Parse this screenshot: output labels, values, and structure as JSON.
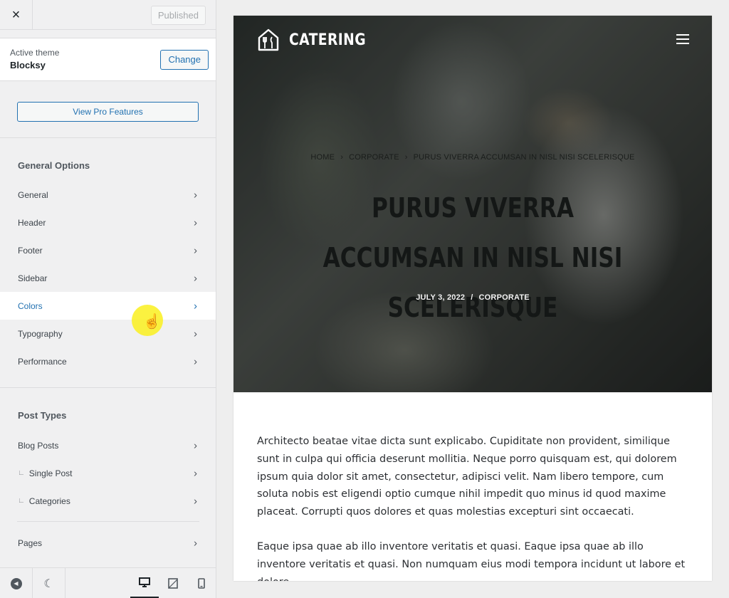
{
  "sidebar": {
    "close_label": "×",
    "publish_label": "Published",
    "active_theme_label": "Active theme",
    "theme_name": "Blocksy",
    "change_label": "Change",
    "pro_label": "View Pro Features",
    "general_options": {
      "title": "General Options",
      "items": [
        {
          "label": "General"
        },
        {
          "label": "Header"
        },
        {
          "label": "Footer"
        },
        {
          "label": "Sidebar"
        },
        {
          "label": "Colors",
          "active": true
        },
        {
          "label": "Typography"
        },
        {
          "label": "Performance"
        }
      ]
    },
    "post_types": {
      "title": "Post Types",
      "items": [
        {
          "label": "Blog Posts"
        },
        {
          "label": "Single Post",
          "sub": true
        },
        {
          "label": "Categories",
          "sub": true
        },
        {
          "label": "Pages"
        }
      ]
    },
    "sub_marker": "∟",
    "chevron": "›",
    "footer": {
      "collapse_icon": "collapse-icon",
      "dark_mode_icon": "moon-icon",
      "devices": [
        "desktop-icon",
        "tablet-icon",
        "mobile-icon"
      ],
      "active_device": "desktop"
    }
  },
  "preview": {
    "site_title": "CATERING",
    "breadcrumbs": [
      "HOME",
      "CORPORATE",
      "PURUS VIVERRA ACCUMSAN IN NISL NISI SCELERISQUE"
    ],
    "breadcrumb_separator": "›",
    "post_title": "PURUS VIVERRA ACCUMSAN IN NISL NISI SCELERISQUE",
    "post_date": "JULY 3, 2022",
    "meta_separator": "/",
    "post_category": "CORPORATE",
    "paragraphs": [
      "Architecto beatae vitae dicta sunt explicabo. Cupiditate non provident, similique sunt in culpa qui officia deserunt mollitia. Neque porro quisquam est, qui dolorem ipsum quia dolor sit amet, consectetur, adipisci velit. Nam libero tempore, cum soluta nobis est eligendi optio cumque nihil impedit quo minus id quod maxime placeat. Corrupti quos dolores et quas molestias excepturi sint occaecati.",
      "Eaque ipsa quae ab illo inventore veritatis et quasi. Eaque ipsa quae ab illo inventore veritatis et quasi. Non numquam eius modi tempora incidunt ut labore et dolore"
    ]
  },
  "colors": {
    "accent": "#2271b1",
    "cursor_highlight": "#faf01e",
    "hero_title": "#141716"
  }
}
